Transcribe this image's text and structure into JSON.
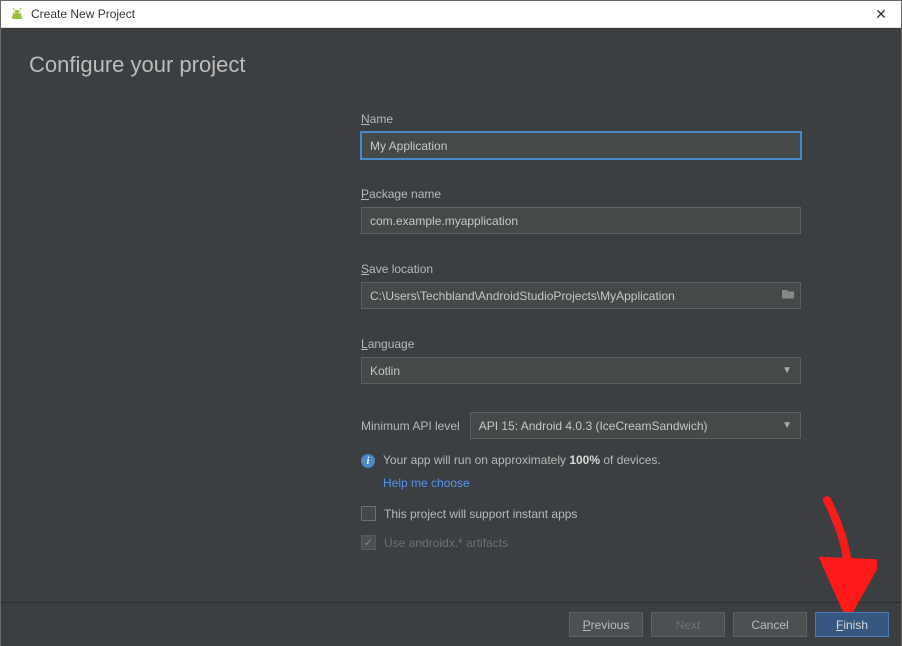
{
  "window": {
    "title": "Create New Project"
  },
  "page": {
    "heading": "Configure your project"
  },
  "form": {
    "name_label_pre": "N",
    "name_label_rest": "ame",
    "name_value": "My Application",
    "package_label_pre": "P",
    "package_label_rest": "ackage name",
    "package_value": "com.example.myapplication",
    "save_label_pre": "S",
    "save_label_rest": "ave location",
    "save_value": "C:\\Users\\Techbland\\AndroidStudioProjects\\MyApplication",
    "language_label_pre": "L",
    "language_label_rest": "anguage",
    "language_value": "Kotlin",
    "api_label": "Minimum API level",
    "api_value": "API 15: Android 4.0.3 (IceCreamSandwich)",
    "info_text_pre": "Your app will run on approximately ",
    "info_text_bold": "100%",
    "info_text_post": " of devices.",
    "help_link": "Help me choose",
    "cb_instant": "This project will support instant apps",
    "cb_androidx": "Use androidx.* artifacts"
  },
  "footer": {
    "previous_pre": "P",
    "previous_rest": "revious",
    "next": "Next",
    "cancel": "Cancel",
    "finish_pre": "F",
    "finish_rest": "inish"
  }
}
